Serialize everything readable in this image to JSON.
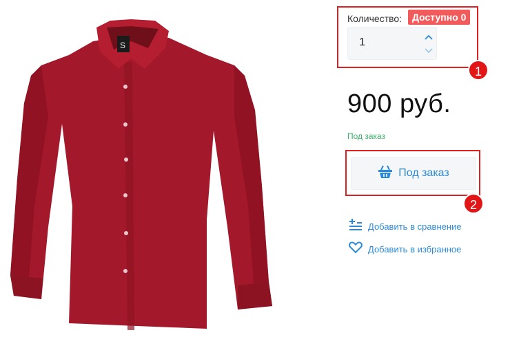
{
  "product": {
    "image_alt": "red shirt"
  },
  "quantity": {
    "label": "Количество:",
    "availability_badge": "Доступно 0",
    "value": "1"
  },
  "price": {
    "text": "900 руб."
  },
  "status": {
    "text": "Под заказ"
  },
  "order_button": {
    "label": "Под заказ",
    "icon": "basket-icon"
  },
  "links": {
    "compare_label": "Добавить в сравнение",
    "favorites_label": "Добавить в избранное"
  },
  "annotations": {
    "callout_1": "1",
    "callout_2": "2"
  },
  "colors": {
    "accent": "#2d8ad8",
    "badge": "#f25b5b",
    "status_green": "#3bb36a",
    "highlight_red": "#e02020",
    "shirt": "#a3182a"
  }
}
